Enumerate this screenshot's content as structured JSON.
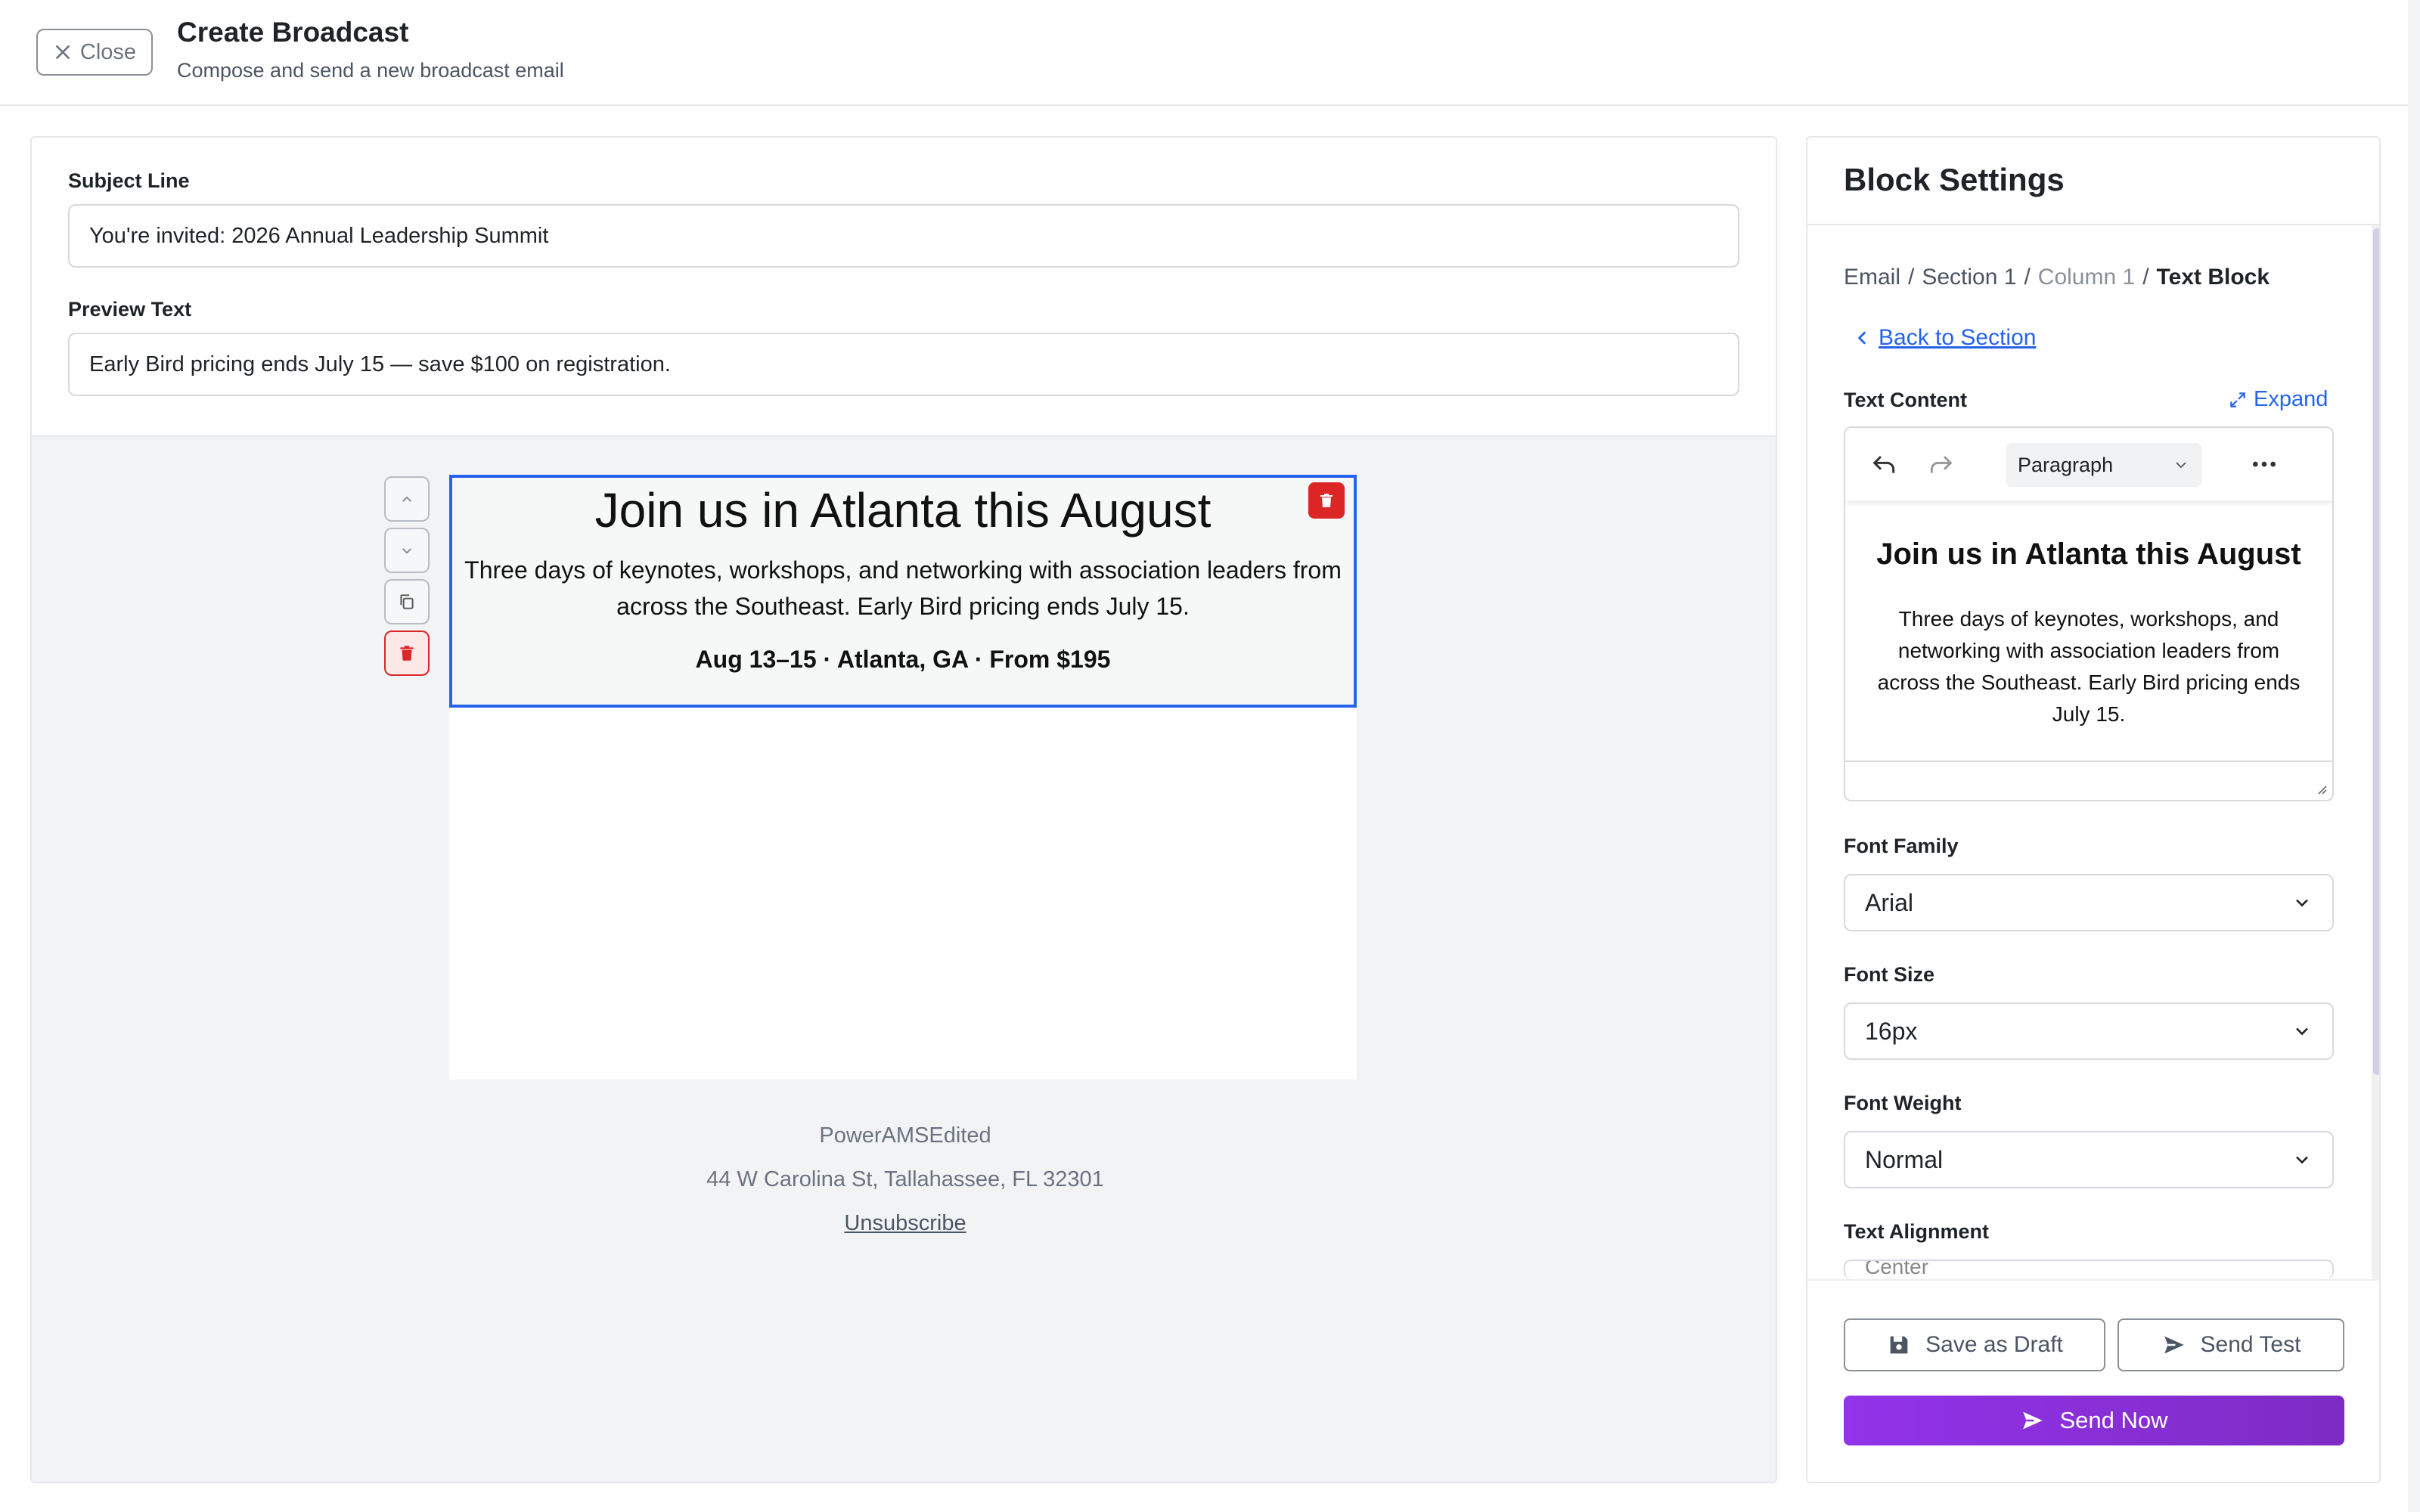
{
  "header": {
    "close_label": "Close",
    "title": "Create Broadcast",
    "subtitle": "Compose and send a new broadcast email"
  },
  "form": {
    "subject_label": "Subject Line",
    "subject_value": "You're invited: 2026 Annual Leadership Summit",
    "preview_label": "Preview Text",
    "preview_value": "Early Bird pricing ends July 15 — save $100 on registration."
  },
  "email": {
    "block": {
      "headline": "Join us in Atlanta this August",
      "body": "Three days of keynotes, workshops, and networking with association leaders from across the Southeast. Early Bird pricing ends July 15.",
      "meta": "Aug 13–15 · Atlanta, GA · From $195"
    },
    "footer": {
      "org": "PowerAMSEdited",
      "address": "44 W Carolina St, Tallahassee, FL 32301",
      "unsubscribe": "Unsubscribe"
    }
  },
  "settings": {
    "title": "Block Settings",
    "breadcrumb": {
      "email": "Email",
      "section": "Section 1",
      "column": "Column 1",
      "current": "Text Block",
      "separator": "/"
    },
    "back_label": " Back to Section",
    "text_content_label": "Text Content",
    "expand_label": "Expand",
    "editor": {
      "format": "Paragraph",
      "heading": "Join us in Atlanta this August",
      "paragraph": "Three days of keynotes, workshops, and networking with association leaders from across the Southeast. Early Bird pricing ends July 15."
    },
    "font_family_label": "Font Family",
    "font_family_value": "Arial",
    "font_size_label": "Font Size",
    "font_size_value": "16px",
    "font_weight_label": "Font Weight",
    "font_weight_value": "Normal",
    "text_alignment_label": "Text Alignment",
    "text_alignment_value": "Center"
  },
  "actions": {
    "save_draft": "Save as Draft",
    "send_test": "Send Test",
    "send_now": "Send Now"
  },
  "colors": {
    "accent_blue": "#2563eb",
    "danger_red": "#dc2626",
    "primary_purple": "#9333ea"
  }
}
